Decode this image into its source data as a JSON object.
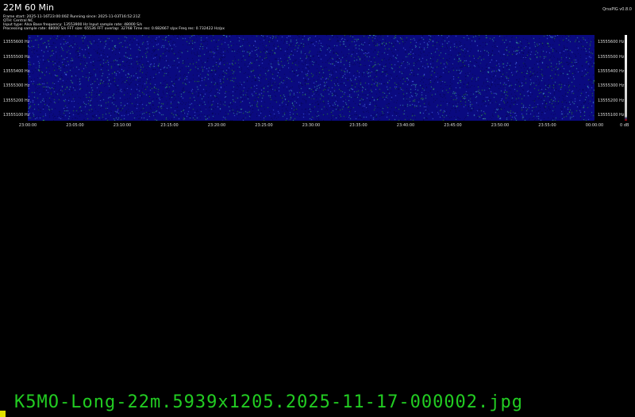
{
  "header": {
    "title": "22M 60 Min",
    "version": "QrssPIG v0.8.0",
    "info_lines": [
      "Frame start: 2025-11-16T23:00:00Z Running since: 2025-11-03T16:52:21Z",
      "QTH: Central NC",
      "Input type: Alsa Base frequency: 13553900 Hz Input sample rate: 48000 S/s",
      "Processing sample rate: 48000 S/s FFT size: 65536 FFT overlap: 32768 Time res: 0.682667 s/px Freq res: 0.732422 Hz/px"
    ]
  },
  "spectrogram": {
    "freq_labels": [
      "13555600 Hz",
      "13555500 Hz",
      "13555400 Hz",
      "13555300 Hz",
      "13555200 Hz",
      "13555100 Hz"
    ],
    "time_labels": [
      "23:00:00",
      "23:05:00",
      "23:10:00",
      "23:15:00",
      "23:20:00",
      "23:25:00",
      "23:30:00",
      "23:35:00",
      "23:40:00",
      "23:45:00",
      "23:50:00",
      "23:55:00",
      "00:00:00"
    ],
    "colorbar_label": "0 dB",
    "background_color": "#0a0a80",
    "dot_colors": [
      "#2a8a2a",
      "#4a6aee",
      "#3aa0a0"
    ]
  },
  "footer": {
    "filename": "K5MO-Long-22m.5939x1205.2025-11-17-000002.jpg"
  }
}
